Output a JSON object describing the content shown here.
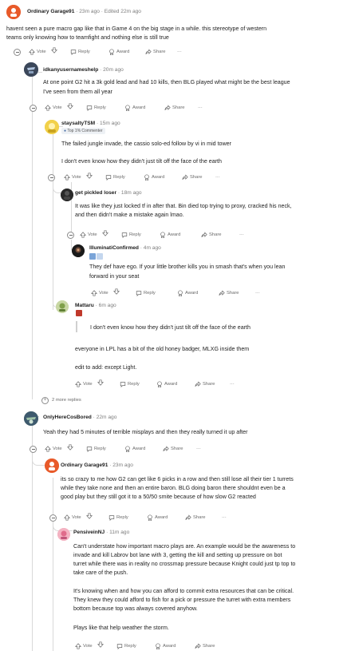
{
  "comments": [
    {
      "id": "c1",
      "author": "Ordinary Garage91",
      "meta": "· 23m ago · Edited 22m ago",
      "lines": [
        "havent seen a pure macro gap like that in Game 4 on the big stage in a while. this stereotype of western",
        "teams only knowing how to teamfight and nothing else is still true"
      ],
      "actions": {
        "vote": "Vote",
        "reply": "Reply",
        "award": "Award",
        "share": "Share",
        "more": "···"
      }
    },
    {
      "id": "c2",
      "author": "idkanyusernameshelp",
      "meta": "· 20m ago",
      "lines": [
        "At one point G2 hit a 3k gold lead and had 10 kills, then BLG played what might be the best league",
        "I've seen from them all year"
      ],
      "actions": {
        "vote": "Vote",
        "reply": "Reply",
        "award": "Award",
        "share": "Share",
        "more": "···"
      }
    },
    {
      "id": "c3",
      "author": "staysaltyTSM",
      "meta": "· 15m ago",
      "flair": "Top 1% Commenter",
      "lines": [
        "The failed jungle invade, the cassio solo-ed follow by vi in mid tower",
        "",
        "I don't even know how they didn't just tilt off the face of the earth"
      ],
      "actions": {
        "vote": "Vote",
        "reply": "Reply",
        "award": "Award",
        "share": "Share",
        "more": "···"
      }
    },
    {
      "id": "c4",
      "author": "get pickled loser",
      "meta": "· 18m ago",
      "lines": [
        "It was like they just locked tf in after that. Bin died top trying to proxy, cracked his neck,",
        "and then didn't make a mistake again lmao."
      ],
      "actions": {
        "vote": "Vote",
        "reply": "Reply",
        "award": "Award",
        "share": "Share",
        "more": "···"
      }
    },
    {
      "id": "c5",
      "author": "IlluminatiConfirmed",
      "meta": "· 4m ago",
      "lines": [
        "They def have ego. If your little brother kills you in smash that's when you lean",
        "forward in your seat"
      ],
      "actions": {
        "vote": "Vote",
        "reply": "Reply",
        "award": "Award",
        "share": "Share",
        "more": "···"
      }
    },
    {
      "id": "c6",
      "author": "Mattaru",
      "meta": "· 6m ago",
      "quote": "I don't even know how they didn't just tilt off the face of the earth",
      "lines": [
        "everyone in LPL has a bit of the old honey badger, MLXG inside them",
        "",
        "edit to add: except Light."
      ],
      "actions": {
        "vote": "Vote",
        "reply": "Reply",
        "award": "Award",
        "share": "Share",
        "more": "···"
      }
    },
    {
      "id": "more",
      "label": "2 more replies"
    },
    {
      "id": "c7",
      "author": "OnlyHereCosBored",
      "meta": "· 22m ago",
      "lines": [
        "Yeah they had 5 minutes of terrible misplays and then they really turned it up after"
      ],
      "actions": {
        "vote": "Vote",
        "reply": "Reply",
        "award": "Award",
        "share": "Share",
        "more": "···"
      }
    },
    {
      "id": "c8",
      "author": "Ordinary Garage91",
      "meta": "· 23m ago",
      "lines": [
        "its so crazy to me how G2 can get like 6 picks in a row and then still lose all their tier 1 turrets",
        "while they take none and then an entire baron. BLG doing baron there shouldnt even be a",
        "good play but they still got it to a 50/50 smite because of how slow G2 reacted"
      ],
      "actions": {
        "vote": "Vote",
        "reply": "Reply",
        "award": "Award",
        "share": "Share",
        "more": "···"
      }
    },
    {
      "id": "c9",
      "author": "PensiveinNJ",
      "meta": "· 11m ago",
      "lines": [
        "Can't understate how important macro plays are. An example would be the awareness to",
        "invade and kill Labrov bot lane with 3, getting the kill and setting up pressure on bot",
        "turret while there was in reality no crossmap pressure because Knight could just tp top to",
        "take care of the push.",
        "",
        "It's knowing when and how you can afford to commit extra resources that can be critical.",
        "They knew they could afford to fish for a pick or pressure the turret with extra members",
        "bottom because top was always covered anyhow.",
        "",
        "Plays like that help weather the storm."
      ],
      "actions": {
        "vote": "Vote",
        "reply": "Reply",
        "award": "Award",
        "share": "Share",
        "more": "···"
      }
    }
  ],
  "colors": {
    "meta": "#7c7c7c",
    "thread": "#d9d9d9",
    "text": "#222222"
  },
  "icons": [
    "upvote-icon",
    "downvote-icon",
    "reply-icon",
    "award-icon",
    "share-icon",
    "collapse-icon"
  ]
}
